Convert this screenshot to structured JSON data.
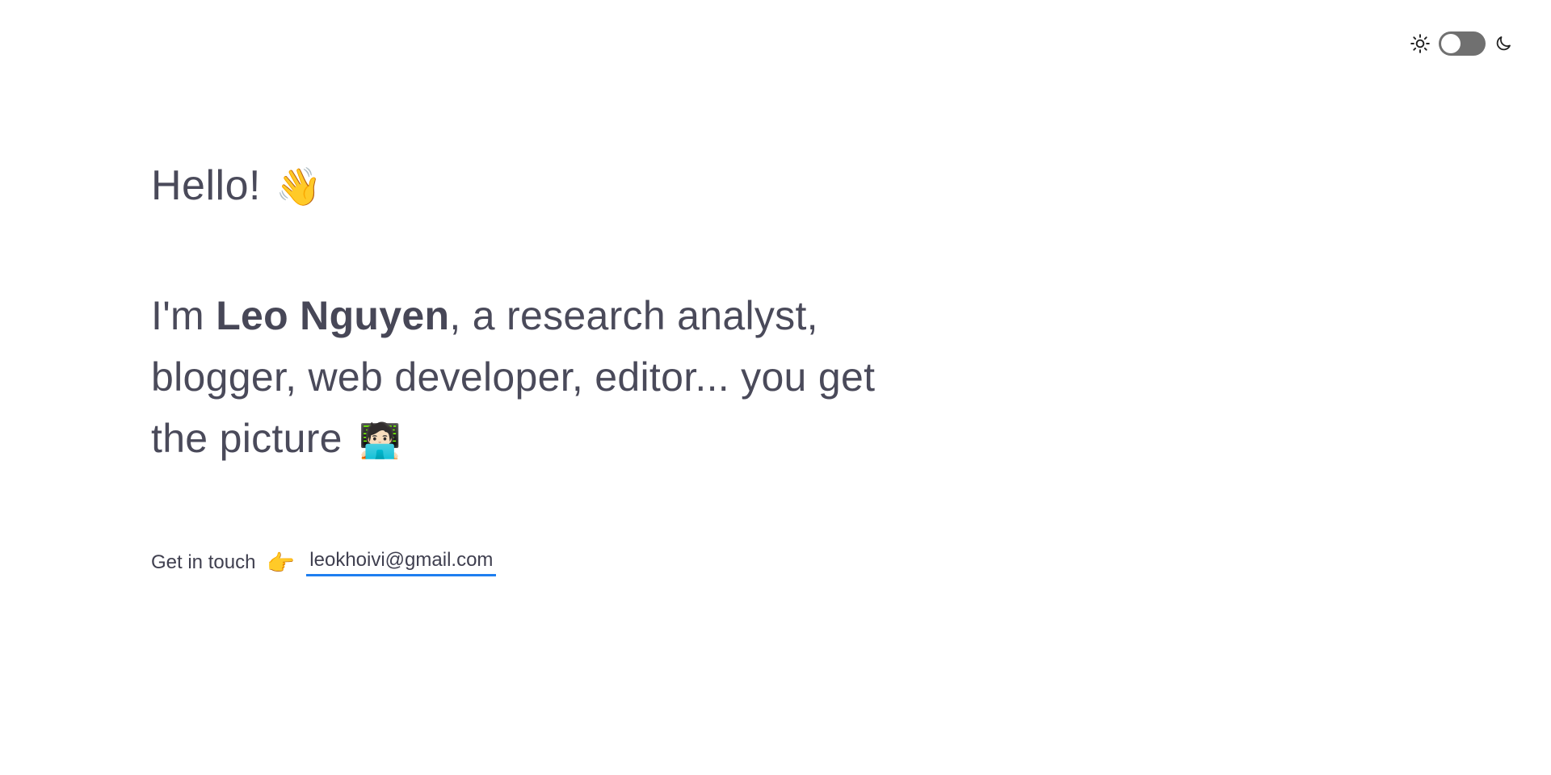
{
  "theme_toggle": {
    "sun_icon": "sun-icon",
    "moon_icon": "moon-icon",
    "state": "light",
    "track_color": "#707070"
  },
  "hero": {
    "greeting": "Hello!",
    "greeting_emoji": "👋",
    "intro_prefix": "I'm ",
    "name": "Leo Nguyen",
    "intro_suffix": ", a research analyst, blogger, web developer, editor... you get the picture",
    "intro_emoji": "🧑🏻‍💻"
  },
  "contact": {
    "label": "Get in touch",
    "pointer_emoji": "👉",
    "email": "leokhoivi@gmail.com",
    "email_href": "mailto:leokhoivi@gmail.com",
    "link_underline_color": "#1e7ef0"
  }
}
